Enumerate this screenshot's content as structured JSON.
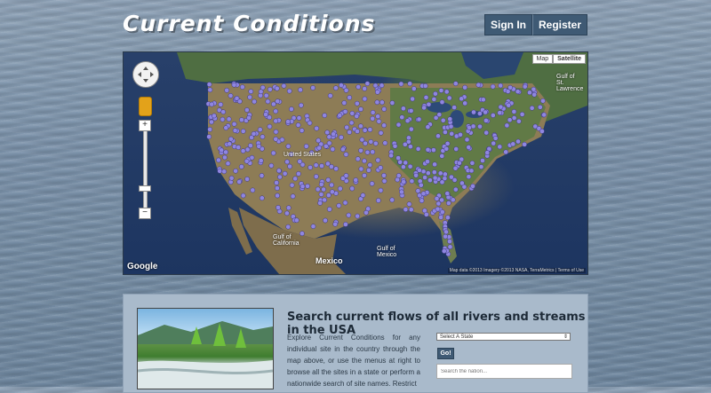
{
  "header": {
    "site_title": "Current Conditions",
    "sign_in_label": "Sign In",
    "register_label": "Register"
  },
  "map": {
    "map_type_map": "Map",
    "map_type_satellite": "Satellite",
    "zoom_in": "+",
    "zoom_out": "−",
    "labels": {
      "united_states": "United States",
      "mexico": "Mexico",
      "gulf_of_mexico": "Gulf of Mexico",
      "gulf_of_california": "Gulf of California",
      "gulf_of_st_lawrence": "Gulf of St. Lawrence"
    },
    "logo": "Google",
    "attribution": "Map data ©2013 Imagery ©2013 NASA, TerraMetrics | Terms of Use",
    "marker_color": "#8f86e0"
  },
  "panel": {
    "headline": "Search current flows of all rivers and streams in the USA",
    "body": "Explore Current Conditions for any individual site in the country through the map above, or use the menus at right to browse all the sites in a state or perform a nationwide search of site names. Restrict",
    "state_select_value": "Select A State",
    "go_label": "Go!",
    "search_placeholder": "Search the nation..."
  }
}
